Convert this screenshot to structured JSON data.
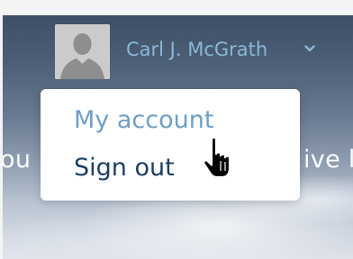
{
  "user": {
    "name": "Carl J. McGrath",
    "avatar_icon": "user-placeholder-icon",
    "menu_icon": "chevron-down-icon"
  },
  "hero": {
    "text_left": "ou",
    "text_right": "ive l"
  },
  "menu": {
    "items": [
      {
        "label": "My account"
      },
      {
        "label": "Sign out"
      }
    ]
  },
  "colors": {
    "name": "#8ab8d5",
    "hovered_item": "#6f9fc6",
    "item": "#1e3f63",
    "menu_background": "#ffffff"
  },
  "cursor": "hand-pointer-icon"
}
